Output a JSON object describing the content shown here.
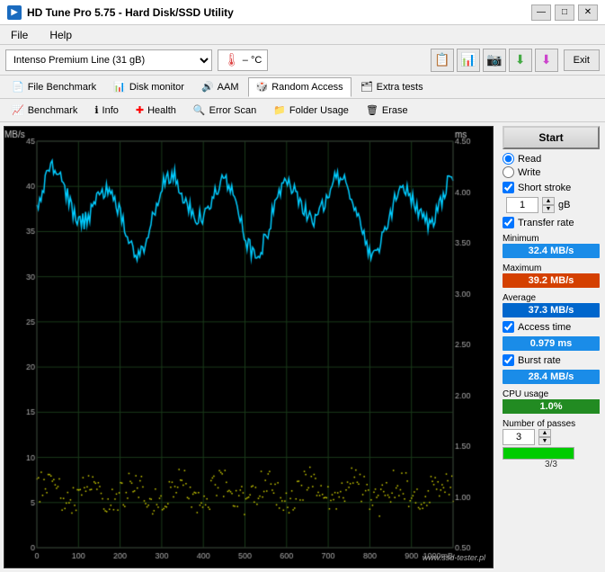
{
  "titlebar": {
    "title": "HD Tune Pro 5.75 - Hard Disk/SSD Utility",
    "icon_text": "HD",
    "minimize": "—",
    "maximize": "□",
    "close": "✕"
  },
  "menu": {
    "file": "File",
    "help": "Help"
  },
  "toolbar": {
    "device": "Intenso Premium Line (31 gB)",
    "temp": "– °C",
    "exit": "Exit"
  },
  "tabs_row1": [
    {
      "label": "File Benchmark",
      "icon": "📄"
    },
    {
      "label": "Disk monitor",
      "icon": "📊"
    },
    {
      "label": "AAM",
      "icon": "🔊"
    },
    {
      "label": "Random Access",
      "icon": "🎲"
    },
    {
      "label": "Extra tests",
      "icon": "🗂"
    }
  ],
  "tabs_row2": [
    {
      "label": "Benchmark",
      "icon": "📈"
    },
    {
      "label": "Info",
      "icon": "ℹ"
    },
    {
      "label": "Health",
      "icon": "❤"
    },
    {
      "label": "Error Scan",
      "icon": "🔍"
    },
    {
      "label": "Folder Usage",
      "icon": "📁"
    },
    {
      "label": "Erase",
      "icon": "🗑"
    }
  ],
  "chart": {
    "y_left_unit": "MB/s",
    "y_right_unit": "ms",
    "y_left_max": 45,
    "y_right_max": 4.5,
    "x_max": "1000mB",
    "x_labels": [
      0,
      100,
      200,
      300,
      400,
      500,
      600,
      700,
      800,
      900
    ]
  },
  "panel": {
    "start_label": "Start",
    "read_label": "Read",
    "write_label": "Write",
    "short_stroke_label": "Short stroke",
    "short_stroke_value": "1",
    "short_stroke_unit": "gB",
    "transfer_rate_label": "Transfer rate",
    "minimum_label": "Minimum",
    "minimum_value": "32.4 MB/s",
    "maximum_label": "Maximum",
    "maximum_value": "39.2 MB/s",
    "average_label": "Average",
    "average_value": "37.3 MB/s",
    "access_time_label": "Access time",
    "access_time_checked": true,
    "access_time_value": "0.979 ms",
    "burst_rate_label": "Burst rate",
    "burst_rate_checked": true,
    "burst_rate_value": "28.4 MB/s",
    "cpu_usage_label": "CPU usage",
    "cpu_usage_value": "1.0%",
    "passes_label": "Number of passes",
    "passes_value": "3",
    "passes_progress": "3/3"
  },
  "watermark": "www.ssd-tester.pl"
}
